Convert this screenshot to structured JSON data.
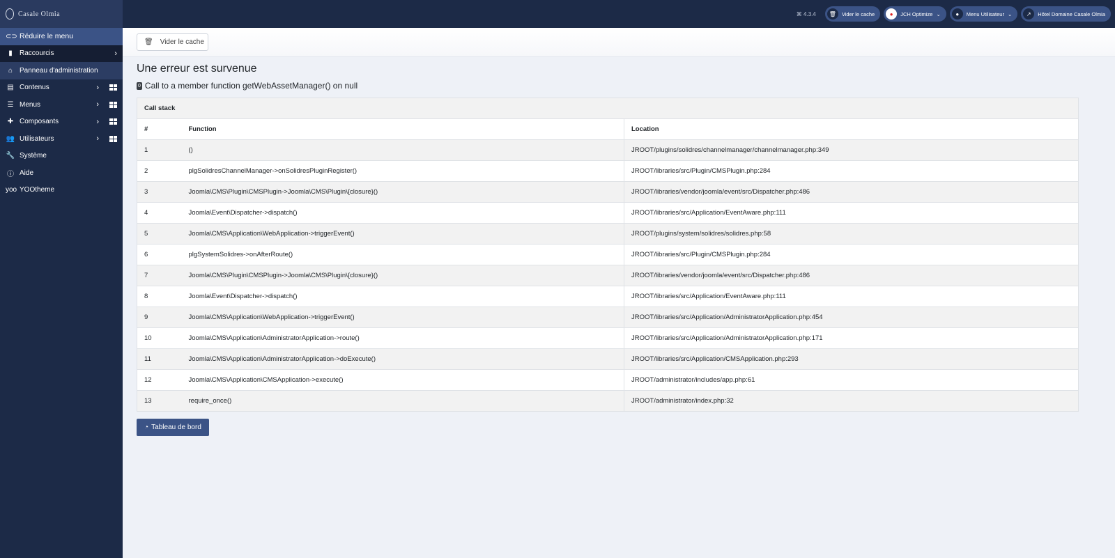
{
  "sidebar": {
    "logo": "Casale Olmia",
    "items": [
      {
        "label": "Réduire le menu",
        "icon": "toggle-icon"
      },
      {
        "label": "Raccourcis",
        "icon": "bookmark-icon"
      },
      {
        "label": "Panneau d'administration",
        "icon": "home-icon"
      },
      {
        "label": "Contenus",
        "icon": "file-icon"
      },
      {
        "label": "Menus",
        "icon": "list-icon"
      },
      {
        "label": "Composants",
        "icon": "puzzle-icon"
      },
      {
        "label": "Utilisateurs",
        "icon": "users-icon"
      },
      {
        "label": "Système",
        "icon": "wrench-icon"
      },
      {
        "label": "Aide",
        "icon": "info-icon"
      },
      {
        "label": "YOOtheme",
        "icon": "yootheme-icon"
      }
    ]
  },
  "header": {
    "version": "4.3.4",
    "clear_cache": "Vider le cache",
    "jch": "JCH Optimize",
    "user_menu": "Menu Utilisateur",
    "site": "Hôtel Domaine Casale Olmia"
  },
  "toolbar": {
    "clear_cache": "Vider le cache"
  },
  "error": {
    "title": "Une erreur est survenue",
    "code": "0",
    "message": "Call to a member function getWebAssetManager() on null"
  },
  "callstack": {
    "caption": "Call stack",
    "headers": [
      "#",
      "Function",
      "Location"
    ],
    "rows": [
      [
        "1",
        "()",
        "JROOT/plugins/solidres/channelmanager/channelmanager.php:349"
      ],
      [
        "2",
        "plgSolidresChannelManager->onSolidresPluginRegister()",
        "JROOT/libraries/src/Plugin/CMSPlugin.php:284"
      ],
      [
        "3",
        "Joomla\\CMS\\Plugin\\CMSPlugin->Joomla\\CMS\\Plugin\\{closure}()",
        "JROOT/libraries/vendor/joomla/event/src/Dispatcher.php:486"
      ],
      [
        "4",
        "Joomla\\Event\\Dispatcher->dispatch()",
        "JROOT/libraries/src/Application/EventAware.php:111"
      ],
      [
        "5",
        "Joomla\\CMS\\Application\\WebApplication->triggerEvent()",
        "JROOT/plugins/system/solidres/solidres.php:58"
      ],
      [
        "6",
        "plgSystemSolidres->onAfterRoute()",
        "JROOT/libraries/src/Plugin/CMSPlugin.php:284"
      ],
      [
        "7",
        "Joomla\\CMS\\Plugin\\CMSPlugin->Joomla\\CMS\\Plugin\\{closure}()",
        "JROOT/libraries/vendor/joomla/event/src/Dispatcher.php:486"
      ],
      [
        "8",
        "Joomla\\Event\\Dispatcher->dispatch()",
        "JROOT/libraries/src/Application/EventAware.php:111"
      ],
      [
        "9",
        "Joomla\\CMS\\Application\\WebApplication->triggerEvent()",
        "JROOT/libraries/src/Application/AdministratorApplication.php:454"
      ],
      [
        "10",
        "Joomla\\CMS\\Application\\AdministratorApplication->route()",
        "JROOT/libraries/src/Application/AdministratorApplication.php:171"
      ],
      [
        "11",
        "Joomla\\CMS\\Application\\AdministratorApplication->doExecute()",
        "JROOT/libraries/src/Application/CMSApplication.php:293"
      ],
      [
        "12",
        "Joomla\\CMS\\Application\\CMSApplication->execute()",
        "JROOT/administrator/includes/app.php:61"
      ],
      [
        "13",
        "require_once()",
        "JROOT/administrator/index.php:32"
      ]
    ]
  },
  "dashboard_button": "Tableau de bord"
}
